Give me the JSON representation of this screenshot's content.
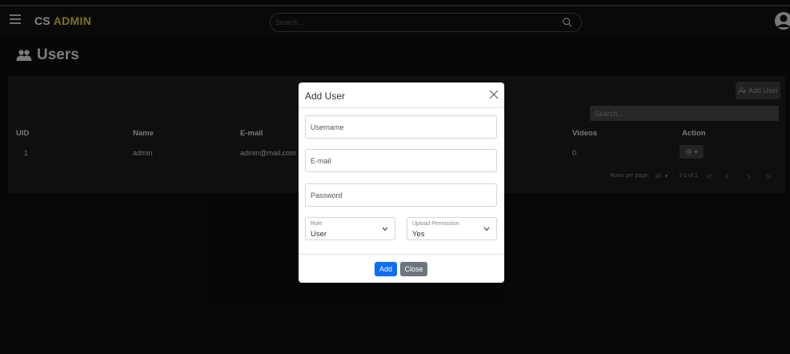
{
  "app": {
    "brand_first": "CS",
    "brand_second": "ADMIN",
    "search_placeholder": "Search...",
    "colors": {
      "brand_accent": "#d9c332",
      "primary": "#0d6efd",
      "secondary": "#6c757d"
    }
  },
  "page": {
    "title": "Users",
    "title_icon": "users-icon"
  },
  "card": {
    "add_user_label": "Add User",
    "add_user_icon": "add-user-icon",
    "search_placeholder": "Search..."
  },
  "table": {
    "headers": [
      "UID",
      "Name",
      "E-mail",
      "Videos",
      "Action"
    ],
    "rows": [
      {
        "uid": "1",
        "name": "admin",
        "email": "admin@mail.com",
        "videos": "0"
      }
    ],
    "action_icon": "gear-icon",
    "footer": {
      "rows_per_page_label": "Rows per page:",
      "rows_per_page_value": "10",
      "range": "1-1 of 1"
    }
  },
  "modal": {
    "title": "Add User",
    "username_placeholder": "Username",
    "email_placeholder": "E-mail",
    "password_placeholder": "Password",
    "role_label": "Role",
    "role_value": "User",
    "upload_label": "Upload Permission",
    "upload_value": "Yes",
    "add_label": "Add",
    "close_label": "Close"
  }
}
